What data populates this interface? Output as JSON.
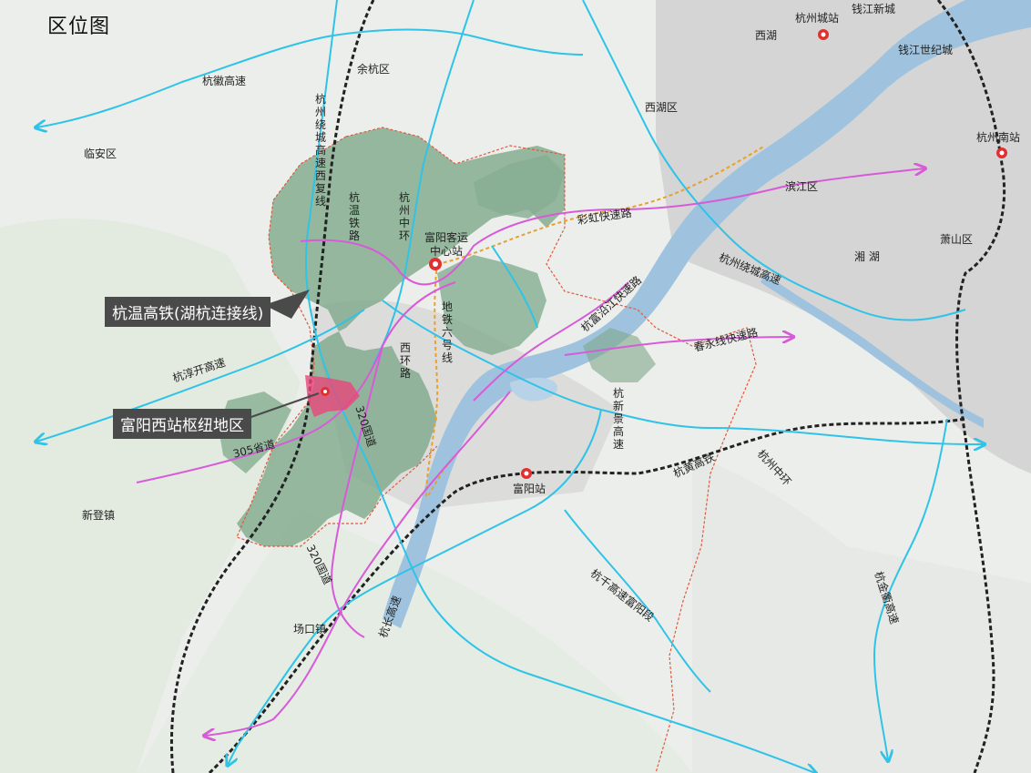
{
  "map": {
    "title": "区位图",
    "callouts": [
      {
        "id": "hsr",
        "text": "杭温高铁(湖杭连接线)"
      },
      {
        "id": "hub",
        "text": "富阳西站枢纽地区"
      }
    ],
    "districts": [
      "临安区",
      "余杭区",
      "西湖区",
      "西湖",
      "滨江区",
      "萧山区",
      "湘 湖",
      "钱江新城",
      "钱江世纪城",
      "新登镇",
      "场口镇"
    ],
    "stations": [
      "杭州城站",
      "杭州南站",
      "富阳客运中心站",
      "富阳站"
    ],
    "roads": [
      "杭徽高速",
      "杭淳开高速",
      "彩虹快速路",
      "杭州绕城高速",
      "春永线快速路",
      "杭富沿江快速路",
      "305省道",
      "杭州中环",
      "杭黄高铁",
      "杭新景高速",
      "西环路",
      "地铁六号线",
      "杭州绕城高速西复线",
      "杭温铁路",
      "320国道",
      "320国道",
      "杭金衢高速",
      "杭长高速",
      "杭千高速富阳段"
    ],
    "colors": {
      "base": "#e9ece8",
      "forest": "#7fa98b",
      "water": "#9fc3de",
      "boundary": "#e05a3f",
      "rail": "#222222",
      "highway": "#2fc3e8",
      "expressway": "#d85ad8",
      "metro": "#e8a030",
      "hub": "#e8467a"
    }
  }
}
